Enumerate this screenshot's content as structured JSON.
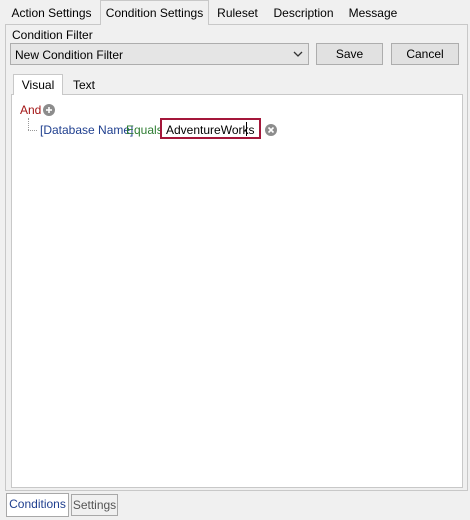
{
  "top_tabs": [
    {
      "label": "Action Settings"
    },
    {
      "label": "Condition Settings"
    },
    {
      "label": "Ruleset"
    },
    {
      "label": "Description"
    },
    {
      "label": "Message"
    }
  ],
  "condition_filter": {
    "label": "Condition Filter",
    "selected": "New Condition Filter",
    "save_label": "Save",
    "cancel_label": "Cancel"
  },
  "inner_tabs": [
    {
      "label": "Visual"
    },
    {
      "label": "Text"
    }
  ],
  "visual": {
    "group_operator": "And",
    "condition": {
      "field": "[Database Name]",
      "operator": "Equals",
      "value": "AdventureWorks"
    }
  },
  "bottom_tabs": [
    {
      "label": "Conditions"
    },
    {
      "label": "Settings"
    }
  ],
  "icons": {
    "add": "plus-circle-icon",
    "remove": "x-circle-icon",
    "dropdown": "chevron-down-icon"
  },
  "colors": {
    "and": "#a31515",
    "field": "#1f3f8f",
    "operator": "#2e7d32",
    "highlight_border": "#a4173a"
  }
}
